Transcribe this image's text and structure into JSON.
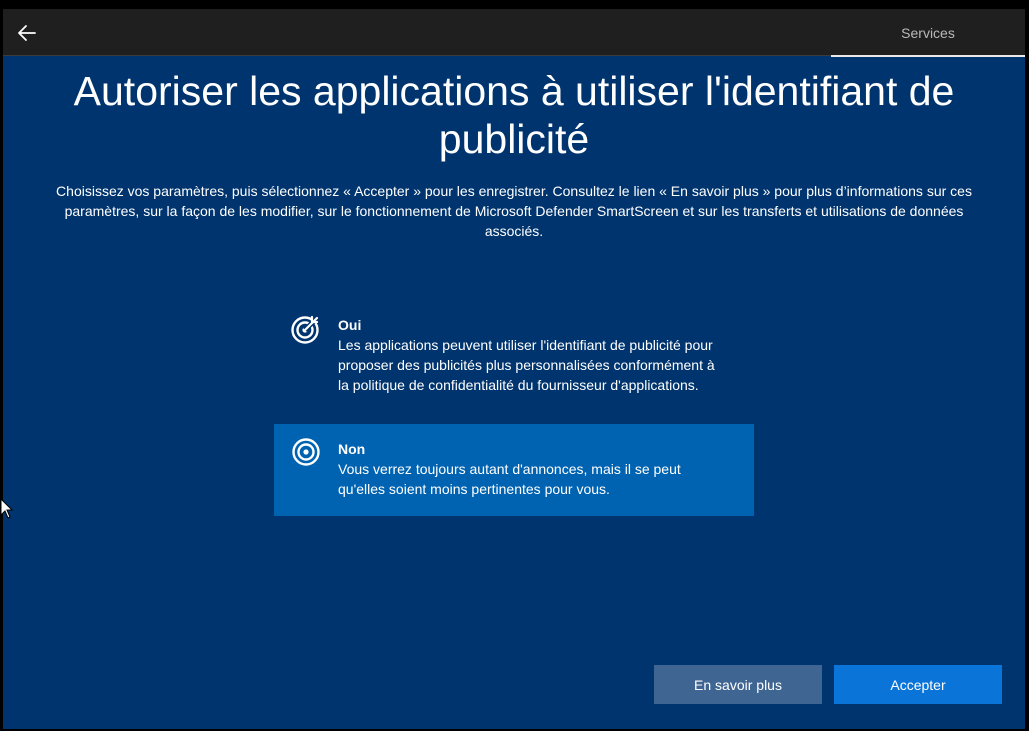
{
  "header": {
    "back_icon": "arrow-left-icon",
    "tab_label": "Services"
  },
  "main": {
    "title": "Autoriser les applications à utiliser l'identifiant de publicité",
    "description": "Choisissez vos paramètres, puis sélectionnez « Accepter » pour les enregistrer. Consultez le lien « En savoir plus » pour plus d’informations sur ces paramètres, sur la façon de les modifier, sur le fonctionnement de Microsoft Defender SmartScreen et sur les transferts et utilisations de données associés."
  },
  "options": [
    {
      "title": "Oui",
      "body": "Les applications peuvent utiliser l'identifiant de publicité pour proposer des publicités plus personnalisées conformément à la politique de confidentialité du fournisseur d'applications.",
      "icon": "target-arrow-icon",
      "selected": false
    },
    {
      "title": "Non",
      "body": "Vous verrez toujours autant d'annonces, mais il se peut qu'elles soient moins pertinentes pour vous.",
      "icon": "target-icon",
      "selected": true
    }
  ],
  "footer": {
    "learn_more_label": "En savoir plus",
    "accept_label": "Accepter"
  },
  "colors": {
    "background": "#00346e",
    "selected_option": "#0063b1",
    "accept_button": "#0a74d8",
    "secondary_button": "#3f6693"
  }
}
